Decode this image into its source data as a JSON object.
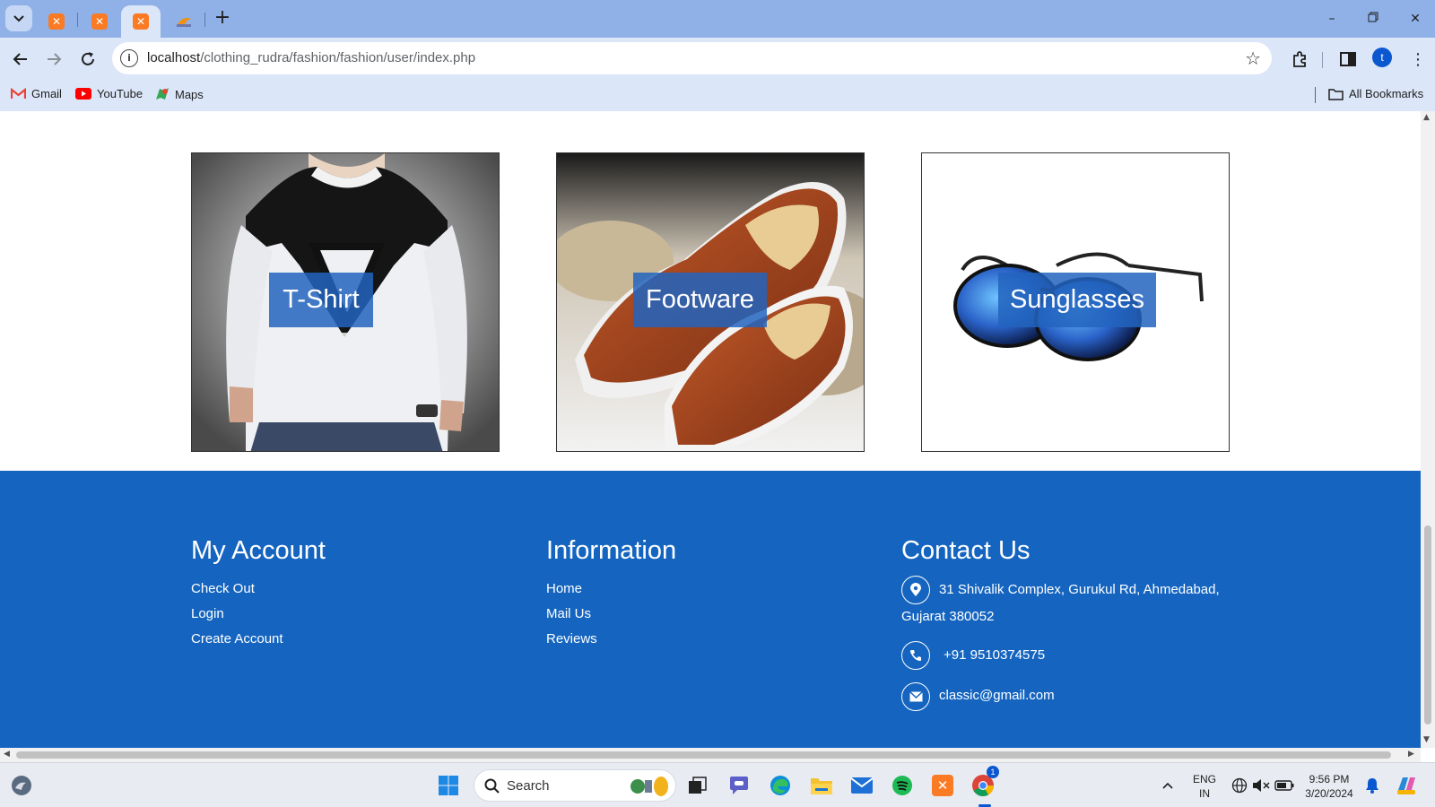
{
  "browser": {
    "url_host": "localhost",
    "url_path": "/clothing_rudra/fashion/fashion/user/index.php",
    "profile_initial": "t",
    "bookmarks": [
      {
        "label": "Gmail",
        "icon": "gmail-icon"
      },
      {
        "label": "YouTube",
        "icon": "youtube-icon"
      },
      {
        "label": "Maps",
        "icon": "maps-icon"
      }
    ],
    "all_bookmarks": "All Bookmarks"
  },
  "categories": [
    {
      "label": "T-Shirt",
      "image": "tshirt-image"
    },
    {
      "label": "Footware",
      "image": "shoes-image"
    },
    {
      "label": "Sunglasses",
      "image": "sunglasses-image"
    }
  ],
  "footer": {
    "my_account": {
      "title": "My Account",
      "links": [
        "Check Out",
        "Login",
        "Create Account"
      ]
    },
    "information": {
      "title": "Information",
      "links": [
        "Home",
        "Mail Us",
        "Reviews"
      ]
    },
    "contact": {
      "title": "Contact Us",
      "address_line1": "31 Shivalik Complex, Gurukul Rd, Ahmedabad,",
      "address_line2": "Gujarat 380052",
      "phone": "+91 9510374575",
      "email": "classic@gmail.com"
    },
    "bg_color": "#1565c0"
  },
  "taskbar": {
    "search_label": "Search",
    "lang_line1": "ENG",
    "lang_line2": "IN",
    "time": "9:56 PM",
    "date": "3/20/2024",
    "chrome_badge": "1"
  }
}
